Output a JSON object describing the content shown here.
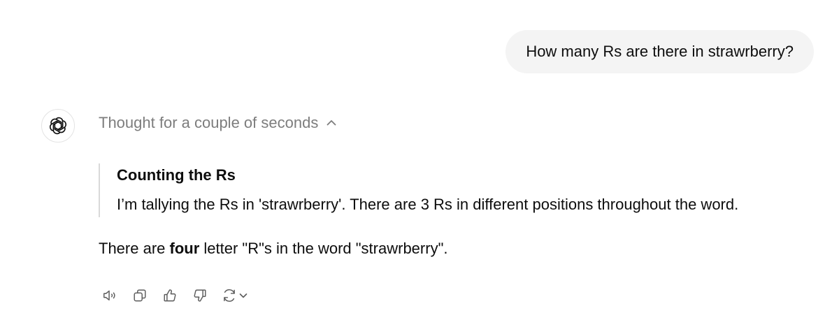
{
  "user_message": {
    "text": "How many Rs are there in strawrberry?"
  },
  "assistant": {
    "avatar_icon": "openai-logo-icon",
    "thought_toggle": {
      "label": "Thought for a couple of seconds",
      "icon": "chevron-up-icon",
      "expanded": true
    },
    "reasoning": {
      "title": "Counting the Rs",
      "body": "I’m tallying the Rs in 'strawrberry'. There are 3 Rs in different positions throughout the word."
    },
    "answer": {
      "prefix": "There are ",
      "bold": "four",
      "suffix": " letter \"R\"s in the word \"strawrberry\"."
    },
    "actions": [
      {
        "name": "read-aloud",
        "icon": "speaker-icon"
      },
      {
        "name": "copy",
        "icon": "copy-icon"
      },
      {
        "name": "good-response",
        "icon": "thumbs-up-icon"
      },
      {
        "name": "bad-response",
        "icon": "thumbs-down-icon"
      },
      {
        "name": "regenerate",
        "icon": "refresh-icon"
      }
    ]
  },
  "colors": {
    "bubble_bg": "#f4f4f4",
    "muted_text": "#7d7d7d",
    "icon": "#5d5d5d",
    "quote_border": "#d9d9d9"
  }
}
